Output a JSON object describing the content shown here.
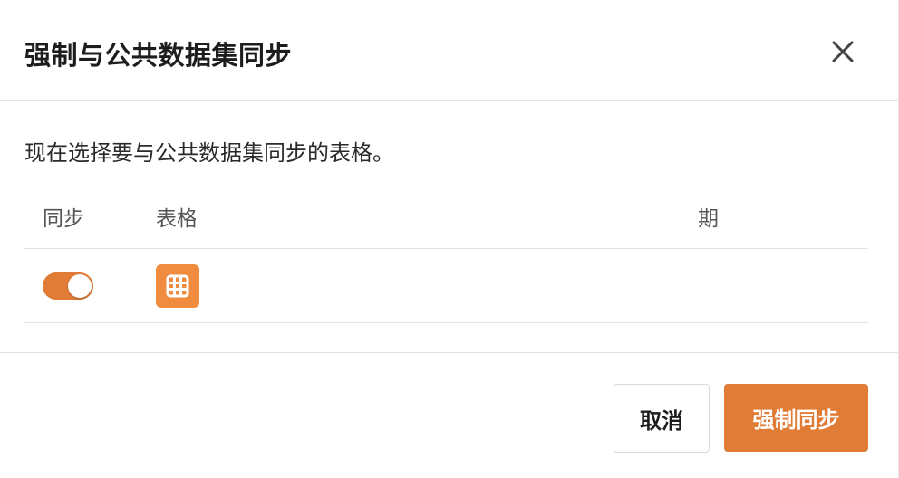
{
  "dialog": {
    "title": "强制与公共数据集同步",
    "close_icon": "close-icon"
  },
  "body": {
    "description": "现在选择要与公共数据集同步的表格。",
    "columns": {
      "sync": "同步",
      "table": "表格",
      "date": "日期"
    },
    "rows": [
      {
        "sync_on": true,
        "icon": "table-grid-icon"
      }
    ]
  },
  "footer": {
    "cancel_label": "取消",
    "force_sync_label": "强制同步"
  },
  "colors": {
    "accent": "#e07c36",
    "table_icon_bg": "#ef8c3f",
    "divider": "#e2e2e6"
  }
}
